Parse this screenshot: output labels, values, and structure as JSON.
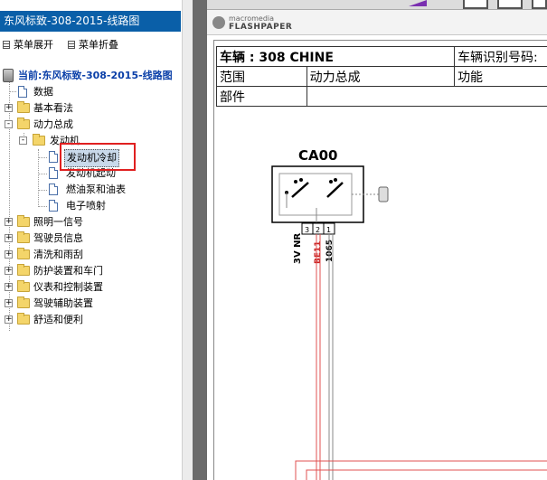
{
  "left_panel": {
    "title": "东风标致-308-2015-线路图",
    "expand_menu": "菜单展开",
    "collapse_menu": "菜单折叠"
  },
  "tree": {
    "root_label": "当前:东风标致-308-2015-线路图",
    "items": [
      {
        "label": "数据",
        "type": "doc"
      },
      {
        "label": "基本看法",
        "type": "folder",
        "state": "+"
      },
      {
        "label": "动力总成",
        "type": "folder",
        "state": "-"
      },
      {
        "label": "发动机",
        "type": "folder",
        "state": "-"
      },
      {
        "label": "发动机冷却",
        "type": "doc",
        "selected": true
      },
      {
        "label": "发动机起动",
        "type": "doc"
      },
      {
        "label": "燃油泵和油表",
        "type": "doc"
      },
      {
        "label": "电子喷射",
        "type": "doc"
      },
      {
        "label": "照明一信号",
        "type": "folder",
        "state": "+"
      },
      {
        "label": "驾驶员信息",
        "type": "folder",
        "state": "+"
      },
      {
        "label": "清洗和雨刮",
        "type": "folder",
        "state": "+"
      },
      {
        "label": "防护装置和车门",
        "type": "folder",
        "state": "+"
      },
      {
        "label": "仪表和控制装置",
        "type": "folder",
        "state": "+"
      },
      {
        "label": "驾驶辅助装置",
        "type": "folder",
        "state": "+"
      },
      {
        "label": "舒适和便利",
        "type": "folder",
        "state": "+"
      }
    ]
  },
  "viewer": {
    "logo_small": "macromedia",
    "logo_big": "FLASHPAPER"
  },
  "document": {
    "row1_col1": "车辆 : 308 CHINE",
    "row1_col2": "车辆识别号码:",
    "row2_col1": "范围",
    "row2_col2": "动力总成",
    "row2_col3": "功能",
    "row3_col1": "部件"
  },
  "diagram": {
    "component_code": "CA00",
    "pins": [
      "3",
      "2",
      "1"
    ],
    "wire_labels": [
      "3V NR",
      "BE11",
      "1065"
    ],
    "colors": {
      "wire_red": "#e05050",
      "wire_gray": "#888888",
      "label_red": "#c81e1e"
    }
  },
  "colors": {
    "title_bar": "#0a5fa8",
    "highlight": "#e02020",
    "selection": "#c9d9ea"
  }
}
